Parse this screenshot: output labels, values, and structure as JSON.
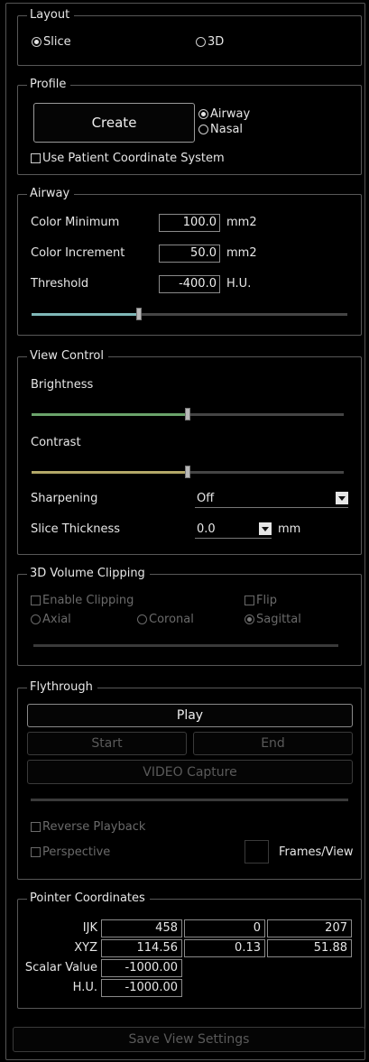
{
  "layout": {
    "title": "Layout",
    "options": [
      {
        "label": "Slice",
        "selected": true
      },
      {
        "label": "3D",
        "selected": false
      }
    ]
  },
  "profile": {
    "title": "Profile",
    "create_label": "Create",
    "types": [
      {
        "label": "Airway",
        "selected": true
      },
      {
        "label": "Nasal",
        "selected": false
      }
    ],
    "patient_coords_label": "Use Patient Coordinate System"
  },
  "airway": {
    "title": "Airway",
    "rows": [
      {
        "label": "Color Minimum",
        "value": "100.0",
        "unit": "mm2"
      },
      {
        "label": "Color Increment",
        "value": "50.0",
        "unit": "mm2"
      },
      {
        "label": "Threshold",
        "value": "-400.0",
        "unit": "H.U."
      }
    ],
    "slider_fraction": 0.34,
    "slider_color": "#7fb8b8"
  },
  "view_control": {
    "title": "View Control",
    "brightness_label": "Brightness",
    "brightness_fraction": 0.5,
    "brightness_color": "#6ba36b",
    "contrast_label": "Contrast",
    "contrast_fraction": 0.5,
    "contrast_color": "#b3a868",
    "sharpening_label": "Sharpening",
    "sharpening_value": "Off",
    "thickness_label": "Slice Thickness",
    "thickness_value": "0.0",
    "thickness_unit": "mm"
  },
  "clipping": {
    "title": "3D Volume Clipping",
    "enable_label": "Enable Clipping",
    "flip_label": "Flip",
    "axes": [
      {
        "label": "Axial",
        "selected": false
      },
      {
        "label": "Coronal",
        "selected": false
      },
      {
        "label": "Sagittal",
        "selected": true
      }
    ]
  },
  "flythrough": {
    "title": "Flythrough",
    "play_label": "Play",
    "start_label": "Start",
    "end_label": "End",
    "video_label": "VIDEO Capture",
    "reverse_label": "Reverse Playback",
    "perspective_label": "Perspective",
    "frames_label": "Frames/View"
  },
  "pointer": {
    "title": "Pointer Coordinates",
    "ijk_label": "IJK",
    "ijk": [
      "458",
      "0",
      "207"
    ],
    "xyz_label": "XYZ",
    "xyz": [
      "114.56",
      "0.13",
      "51.88"
    ],
    "scalar_label": "Scalar Value",
    "scalar": "-1000.00",
    "hu_label": "H.U.",
    "hu": "-1000.00"
  },
  "save_label": "Save View Settings"
}
